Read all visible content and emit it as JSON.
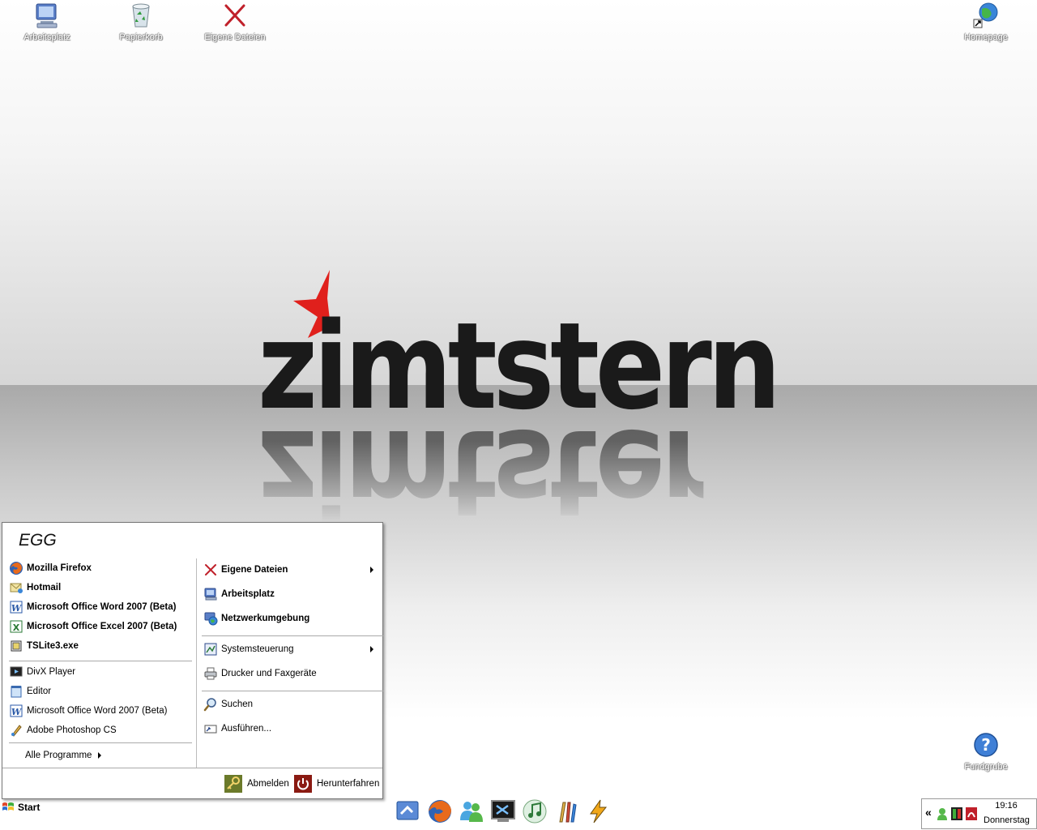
{
  "desktop": {
    "icons": [
      {
        "label": "Arbeitsplatz",
        "icon": "computer-icon"
      },
      {
        "label": "Papierkorb",
        "icon": "recycle-bin-icon"
      },
      {
        "label": "Eigene Dateien",
        "icon": "red-x-icon"
      },
      {
        "label": "Homepage",
        "icon": "globe-shortcut-icon"
      },
      {
        "label": "Fundgrube",
        "icon": "help-question-icon"
      }
    ],
    "wallpaper_logo": "zimtstern"
  },
  "start_menu": {
    "user": "EGG",
    "pinned": [
      {
        "label": "Mozilla Firefox",
        "icon": "firefox-icon"
      },
      {
        "label": "Hotmail",
        "icon": "mail-icon"
      },
      {
        "label": "Microsoft Office Word 2007 (Beta)",
        "icon": "word-icon"
      },
      {
        "label": "Microsoft Office Excel 2007 (Beta)",
        "icon": "excel-icon"
      },
      {
        "label": "TSLite3.exe",
        "icon": "exe-icon"
      }
    ],
    "recent": [
      {
        "label": "DivX Player",
        "icon": "divx-icon"
      },
      {
        "label": "Editor",
        "icon": "notepad-icon"
      },
      {
        "label": "Microsoft Office Word 2007 (Beta)",
        "icon": "word-icon"
      },
      {
        "label": "Adobe Photoshop CS",
        "icon": "photoshop-icon"
      }
    ],
    "all_programs": "Alle Programme",
    "places": [
      {
        "label": "Eigene Dateien",
        "icon": "red-x-icon",
        "submenu": true
      },
      {
        "label": "Arbeitsplatz",
        "icon": "computer-icon",
        "submenu": false
      },
      {
        "label": "Netzwerkumgebung",
        "icon": "network-icon",
        "submenu": false
      }
    ],
    "settings": [
      {
        "label": "Systemsteuerung",
        "icon": "control-panel-icon",
        "submenu": true
      },
      {
        "label": "Drucker und Faxgeräte",
        "icon": "printer-icon",
        "submenu": false
      }
    ],
    "tools": [
      {
        "label": "Suchen",
        "icon": "search-icon"
      },
      {
        "label": "Ausführen...",
        "icon": "run-icon"
      }
    ],
    "logoff": "Abmelden",
    "shutdown": "Herunterfahren"
  },
  "taskbar": {
    "start_label": "Start",
    "quick_launch": [
      "show-desktop-icon",
      "firefox-icon",
      "messenger-icon",
      "terminal-icon",
      "itunes-icon",
      "paint-icon",
      "winamp-icon"
    ],
    "tray": {
      "chevron": "«",
      "time": "19:16",
      "day": "Donnerstag"
    }
  },
  "colors": {
    "logo_star": "#e0201c",
    "logo_text": "#1a1a1a",
    "shutdown_red": "#8a1a12",
    "logoff_green": "#6b7a2a"
  }
}
